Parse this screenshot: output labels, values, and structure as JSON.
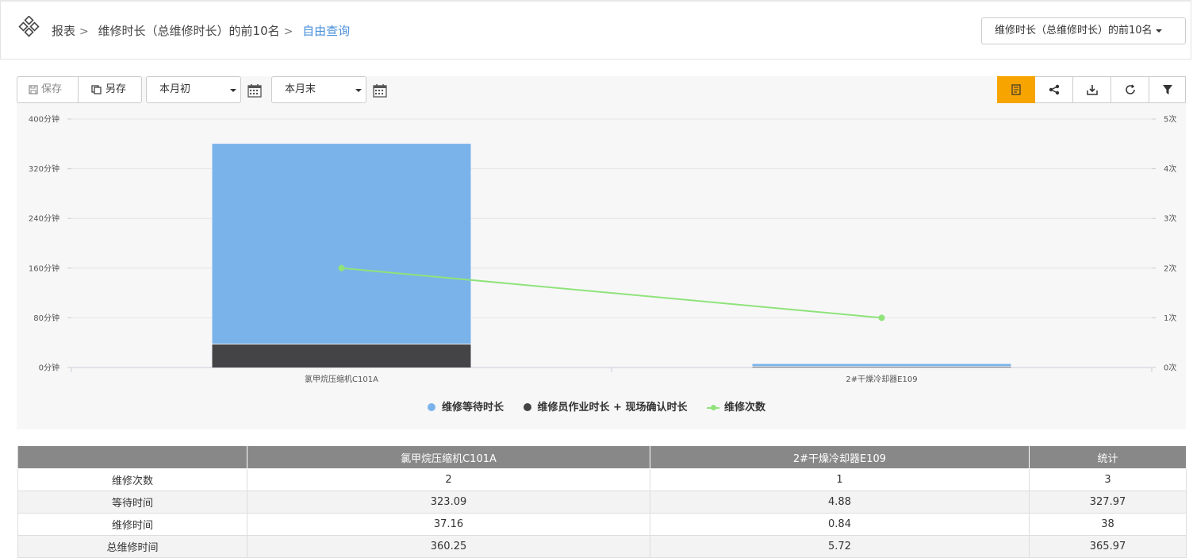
{
  "header": {
    "breadcrumbs": [
      "报表",
      "维修时长（总维修时长）的前10名",
      "自由查询"
    ],
    "report_select": "维修时长（总维修时长）的前10名"
  },
  "toolbar": {
    "save_label": "保存",
    "save_as_label": "另存",
    "start_date": "本月初",
    "end_date": "本月末"
  },
  "icons": [
    "logo-icon",
    "save-icon",
    "save-as-icon",
    "calendar-icon",
    "report-icon",
    "share-icon",
    "download-icon",
    "refresh-icon",
    "filter-icon"
  ],
  "colors": {
    "accent": "#f7a400",
    "wait_bar": "#7ab3ea",
    "work_bar": "#444447",
    "count_line": "#8fe37a",
    "link": "#4a90d9",
    "table_header": "#888888"
  },
  "chart_data": {
    "type": "bar",
    "categories": [
      "氯甲烷压缩机C101A",
      "2#干燥冷却器E109"
    ],
    "series": [
      {
        "name": "维修等待时长",
        "type": "bar",
        "stack": true,
        "axis": "left",
        "values": [
          323.09,
          4.88
        ]
      },
      {
        "name": "维修员作业时长 + 现场确认时长",
        "type": "bar",
        "stack": true,
        "axis": "left",
        "values": [
          37.16,
          0.84
        ]
      },
      {
        "name": "维修次数",
        "type": "line",
        "axis": "right",
        "values": [
          2,
          1
        ]
      }
    ],
    "y_left": {
      "ylim": [
        0,
        400
      ],
      "ticks": [
        "0分钟",
        "80分钟",
        "160分钟",
        "240分钟",
        "320分钟",
        "400分钟"
      ]
    },
    "y_right": {
      "ylim": [
        0,
        5
      ],
      "ticks": [
        "0次",
        "1次",
        "2次",
        "3次",
        "4次",
        "5次"
      ]
    },
    "grid": true,
    "legend": "bottom-center"
  },
  "table": {
    "columns": [
      "",
      "氯甲烷压缩机C101A",
      "2#干燥冷却器E109",
      "统计"
    ],
    "rows": [
      [
        "维修次数",
        "2",
        "1",
        "3"
      ],
      [
        "等待时间",
        "323.09",
        "4.88",
        "327.97"
      ],
      [
        "维修时间",
        "37.16",
        "0.84",
        "38"
      ],
      [
        "总维修时间",
        "360.25",
        "5.72",
        "365.97"
      ]
    ]
  }
}
